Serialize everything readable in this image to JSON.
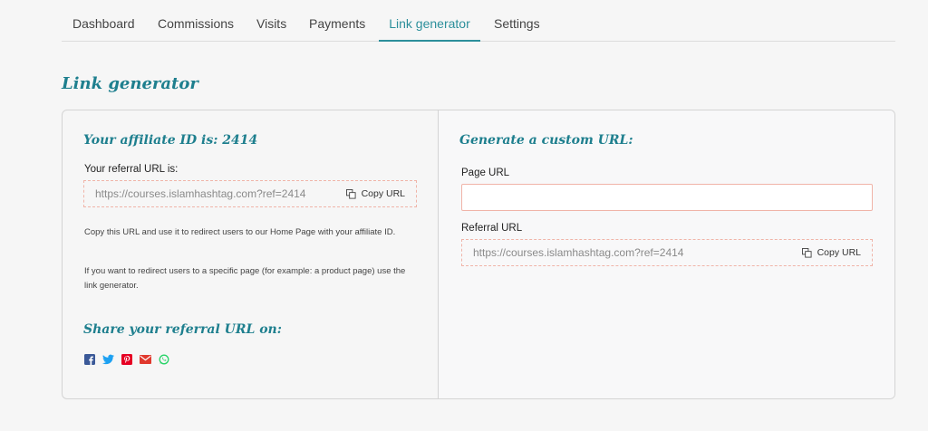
{
  "tabs": [
    {
      "label": "Dashboard"
    },
    {
      "label": "Commissions"
    },
    {
      "label": "Visits"
    },
    {
      "label": "Payments"
    },
    {
      "label": "Link generator"
    },
    {
      "label": "Settings"
    }
  ],
  "page_title": "Link generator",
  "left": {
    "affiliate_heading": "Your affiliate ID is: 2414",
    "referral_label": "Your referral URL is:",
    "referral_url": "https://courses.islamhashtag.com?ref=2414",
    "copy_label": "Copy URL",
    "help_1": "Copy this URL and use it to redirect users to our Home Page with your affiliate ID.",
    "help_2": "If you want to redirect users to a specific page (for example: a product page) use the link generator.",
    "share_heading": "Share your referral URL on:",
    "share_icons": [
      "facebook-icon",
      "twitter-icon",
      "pinterest-icon",
      "email-icon",
      "whatsapp-icon"
    ]
  },
  "right": {
    "heading": "Generate a custom URL:",
    "page_url_label": "Page URL",
    "page_url_value": "",
    "referral_label": "Referral URL",
    "referral_url": "https://courses.islamhashtag.com?ref=2414",
    "copy_label": "Copy URL"
  },
  "colors": {
    "accent": "#2c8f9b",
    "heading": "#1e7f8e",
    "dashed_border": "#f0b4a8",
    "facebook": "#3b5998",
    "twitter": "#1da1f2",
    "pinterest": "#e60023",
    "email": "#e0392e",
    "whatsapp": "#25d366"
  }
}
